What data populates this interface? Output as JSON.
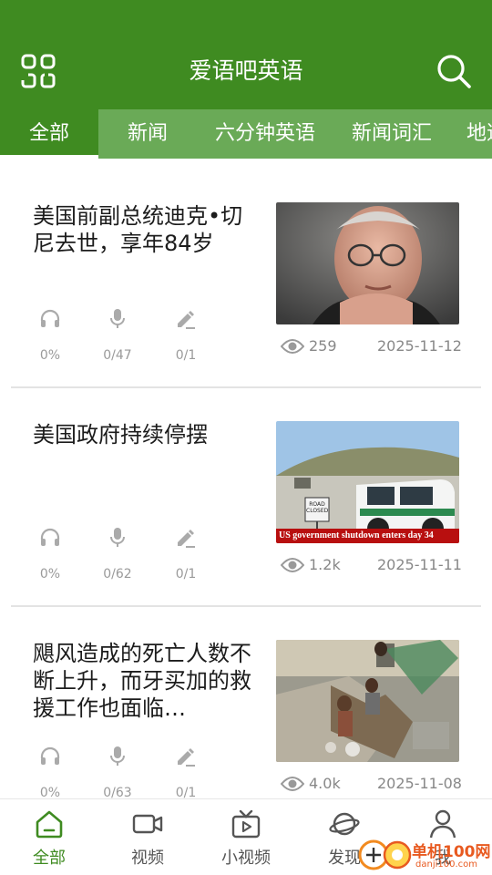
{
  "header": {
    "title": "爱语吧英语",
    "menu_icon": "grid-menu-icon",
    "search_icon": "search-icon",
    "bg_color": "#3f8b21"
  },
  "tabs": [
    {
      "label": "全部",
      "active": true
    },
    {
      "label": "新闻",
      "active": false
    },
    {
      "label": "六分钟英语",
      "active": false
    },
    {
      "label": "新闻词汇",
      "active": false
    },
    {
      "label": "地道",
      "active": false
    }
  ],
  "articles": [
    {
      "headline": "美国前副总统迪克•切尼去世，享年84岁",
      "listen": "0%",
      "speak": "0/47",
      "write": "0/1",
      "views": "259",
      "date": "2025-11-12"
    },
    {
      "headline": "美国政府持续停摆",
      "listen": "0%",
      "speak": "0/62",
      "write": "0/1",
      "views": "1.2k",
      "date": "2025-11-11",
      "image_caption": "US government shutdown enters day 34",
      "sign_text": "ROAD CLOSED"
    },
    {
      "headline": "飓风造成的死亡人数不断上升，而牙买加的救援工作也面临…",
      "listen": "0%",
      "speak": "0/63",
      "write": "0/1",
      "views": "4.0k",
      "date": "2025-11-08"
    }
  ],
  "bottom_nav": [
    {
      "label": "全部",
      "icon": "home-icon",
      "active": true
    },
    {
      "label": "视频",
      "icon": "video-camera-icon",
      "active": false
    },
    {
      "label": "小视频",
      "icon": "tv-play-icon",
      "active": false
    },
    {
      "label": "发现",
      "icon": "planet-icon",
      "active": false
    },
    {
      "label": "我",
      "icon": "user-icon",
      "active": false
    }
  ],
  "watermark": {
    "text": "单机100网",
    "sub": "danji100.com"
  }
}
